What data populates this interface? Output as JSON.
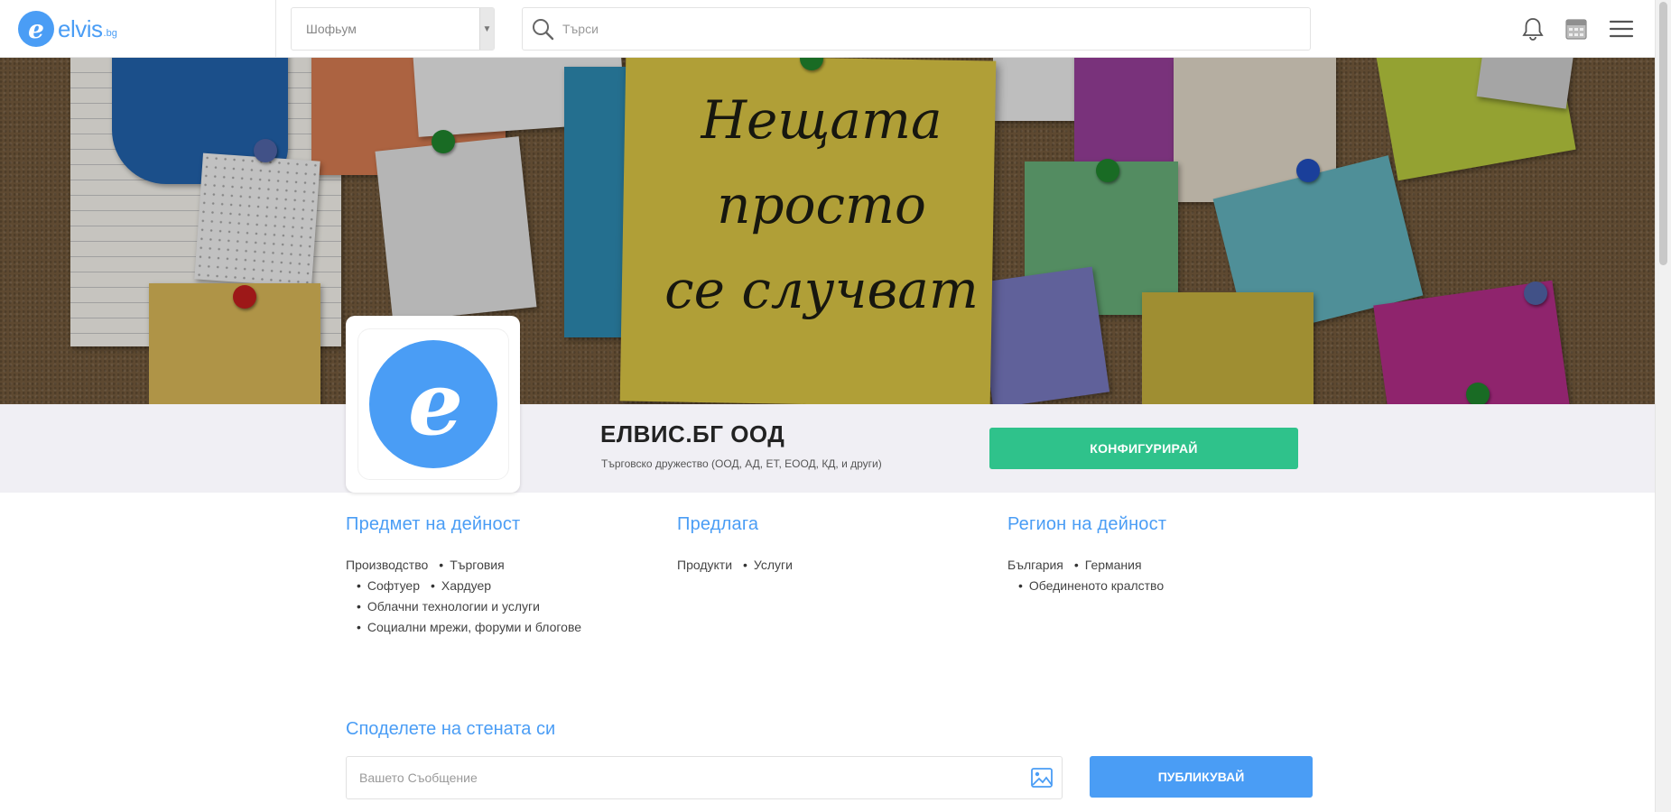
{
  "header": {
    "logo_letter": "e",
    "logo_text": "elvis",
    "logo_tld": ".bg",
    "select_value": "Шофьум",
    "search_placeholder": "Търси"
  },
  "cover": {
    "note_lines": [
      "Нещата",
      "просто",
      "се случват"
    ]
  },
  "profile": {
    "avatar_letter": "e",
    "company_name": "ЕЛВИС.БГ ООД",
    "company_type": "Търговско дружество (ООД, АД, ЕТ, ЕООД, КД, и други)",
    "configure_label": "КОНФИГУРИРАЙ"
  },
  "info": {
    "activity": {
      "title": "Предмет на дейност",
      "tags": [
        "Производство",
        "Търговия",
        "Софтуер",
        "Хардуер",
        "Облачни технологии и услуги",
        "Социални мрежи, форуми и блогове"
      ]
    },
    "offers": {
      "title": "Предлага",
      "tags": [
        "Продукти",
        "Услуги"
      ]
    },
    "region": {
      "title": "Регион на дейност",
      "tags": [
        "България",
        "Германия",
        "Обединеното кралство"
      ]
    }
  },
  "wall": {
    "title": "Споделете на стената си",
    "message_placeholder": "Вашето Съобщение",
    "publish_label": "ПУБЛИКУВАЙ"
  },
  "colors": {
    "brand_blue": "#4a9df5",
    "configure_green": "#2fc28b"
  }
}
